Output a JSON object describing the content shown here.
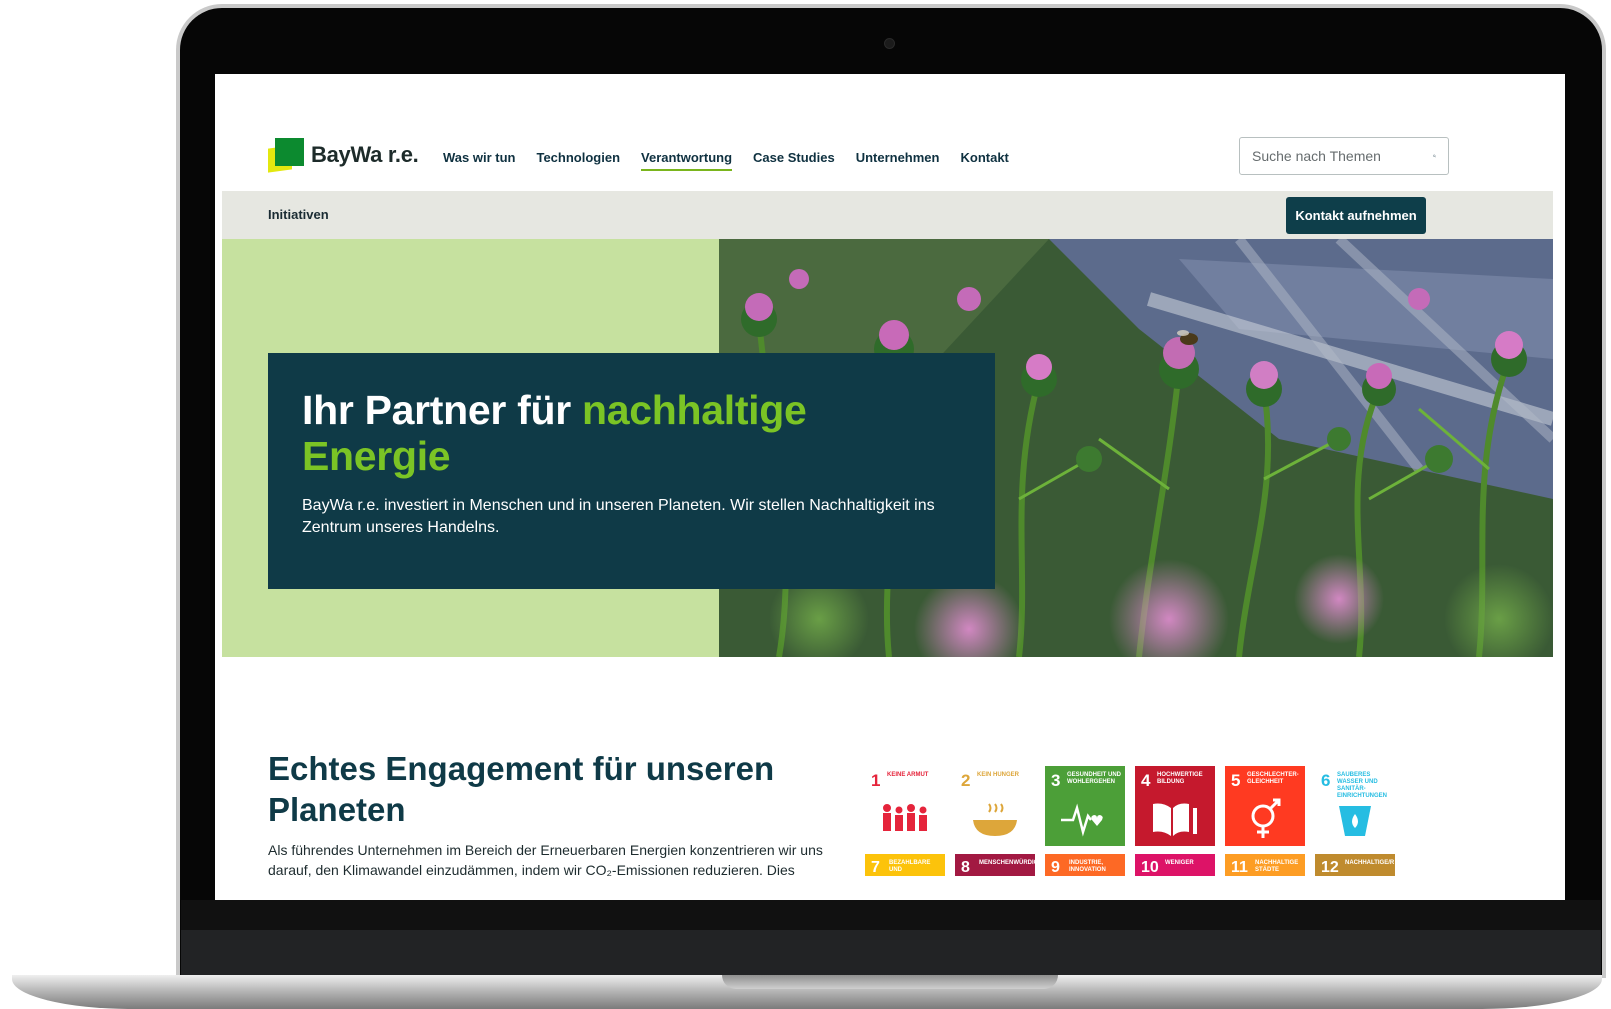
{
  "header": {
    "logo_text": "BayWa r.e.",
    "nav": [
      {
        "label": "Was wir tun",
        "active": false
      },
      {
        "label": "Technologien",
        "active": false
      },
      {
        "label": "Verantwortung",
        "active": true
      },
      {
        "label": "Case Studies",
        "active": false
      },
      {
        "label": "Unternehmen",
        "active": false
      },
      {
        "label": "Kontakt",
        "active": false
      }
    ],
    "search_placeholder": "Suche nach Themen"
  },
  "subnav": {
    "item": "Initiativen",
    "cta_label": "Kontakt aufnehmen"
  },
  "hero": {
    "title_main": "Ihr Partner für ",
    "title_accent": "nachhaltige Energie",
    "text": "BayWa r.e. investiert in Menschen und in unseren Planeten. Wir stellen Nachhaltigkeit ins Zentrum unseres Handelns."
  },
  "section": {
    "title": "Echtes Engagement für unseren Planeten",
    "text": "Als führendes Unternehmen im Bereich der Erneuerbaren Energien konzentrieren wir uns darauf, den Klimawandel einzudämmen, indem wir CO₂-Emissionen reduzieren. Dies"
  },
  "sdg_goals": [
    {
      "num": "1",
      "label": "Keine Armut",
      "color": "#e5243b",
      "icon": "people-icon"
    },
    {
      "num": "2",
      "label": "Kein Hunger",
      "color": "#dda63a",
      "icon": "bowl-icon"
    },
    {
      "num": "3",
      "label": "Gesundheit und Wohlergehen",
      "color": "#4c9f38",
      "icon": "heartbeat-icon"
    },
    {
      "num": "4",
      "label": "Hochwertige Bildung",
      "color": "#c5192d",
      "icon": "book-icon"
    },
    {
      "num": "5",
      "label": "Geschlechter-gleichheit",
      "color": "#ff3a21",
      "icon": "gender-icon"
    },
    {
      "num": "6",
      "label": "Sauberes Wasser und Sanitär-einrichtungen",
      "color": "#26bde2",
      "icon": "water-icon"
    }
  ],
  "sdg_goals_row2": [
    {
      "num": "7",
      "label": "Bezahlbare und",
      "color": "#fcc30b"
    },
    {
      "num": "8",
      "label": "Menschenwürdige",
      "color": "#a21942"
    },
    {
      "num": "9",
      "label": "Industrie, Innovation",
      "color": "#fd6925"
    },
    {
      "num": "10",
      "label": "Weniger",
      "color": "#dd1367"
    },
    {
      "num": "11",
      "label": "Nachhaltige Städte",
      "color": "#fd9d24"
    },
    {
      "num": "12",
      "label": "Nachhaltige/r",
      "color": "#bf8b2e"
    }
  ]
}
